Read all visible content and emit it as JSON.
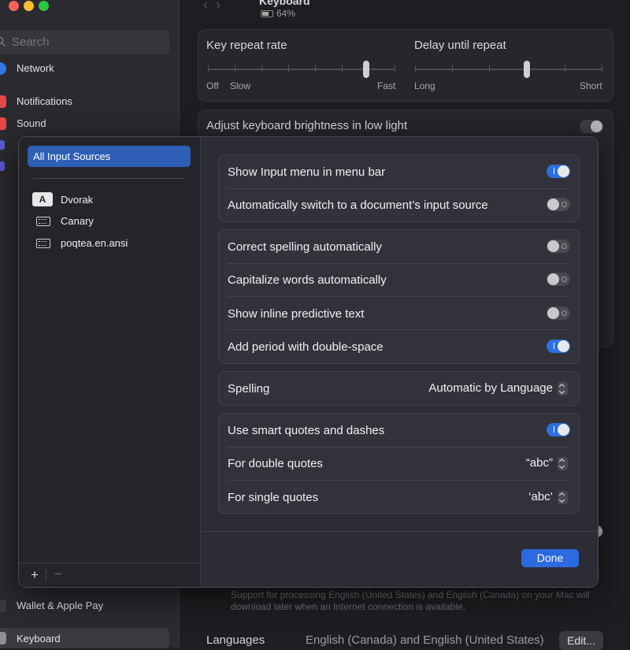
{
  "sidebar": {
    "search_placeholder": "Search",
    "items": [
      {
        "label": "Network",
        "color": "#2f79e8"
      },
      {
        "label": "Notifications",
        "color": "#e5464a"
      },
      {
        "label": "Sound",
        "color": "#e5464a"
      }
    ],
    "bottom_items": [
      {
        "label": "Wallet & Apple Pay",
        "color": "#3a3a40"
      },
      {
        "label": "Keyboard",
        "color": "#8e8e93"
      }
    ]
  },
  "header": {
    "title": "Keyboard",
    "battery": "64%"
  },
  "background": {
    "key_repeat_rate": "Key repeat rate",
    "delay_until_repeat": "Delay until repeat",
    "off": "Off",
    "slow": "Slow",
    "fast": "Fast",
    "long": "Long",
    "short": "Short",
    "brightness_label": "Adjust keyboard brightness in low light",
    "note": "Support for processing English (United States) and English (Canada) on your Mac will download later when an Internet connection is available.",
    "languages_label": "Languages",
    "languages_value": "English (Canada) and English (United States)",
    "edit_button": "Edit..."
  },
  "sheet": {
    "all_input_sources": "All Input Sources",
    "sources": [
      {
        "label": "Dvorak",
        "icon": "letter-a-icon",
        "badge": "A"
      },
      {
        "label": "Canary",
        "icon": "keyboard-icon"
      },
      {
        "label": "poqtea.en.ansi",
        "icon": "keyboard-icon"
      }
    ],
    "add_button": "+",
    "remove_button": "−",
    "group1": [
      {
        "label": "Show Input menu in menu bar",
        "state": "on"
      },
      {
        "label": "Automatically switch to a document’s input source",
        "state": "off"
      }
    ],
    "group2": [
      {
        "label": "Correct spelling automatically",
        "state": "off"
      },
      {
        "label": "Capitalize words automatically",
        "state": "off"
      },
      {
        "label": "Show inline predictive text",
        "state": "off"
      },
      {
        "label": "Add period with double-space",
        "state": "on"
      }
    ],
    "spelling": {
      "label": "Spelling",
      "value": "Automatic by Language"
    },
    "group4": {
      "smart_quotes": {
        "label": "Use smart quotes and dashes",
        "state": "on"
      },
      "double_quotes": {
        "label": "For double quotes",
        "value": "“abc”"
      },
      "single_quotes": {
        "label": "For single quotes",
        "value": "‘abc’"
      }
    },
    "done_button": "Done"
  },
  "colors": {
    "accent": "#2f6fdf",
    "selection": "#2e5fb7"
  }
}
